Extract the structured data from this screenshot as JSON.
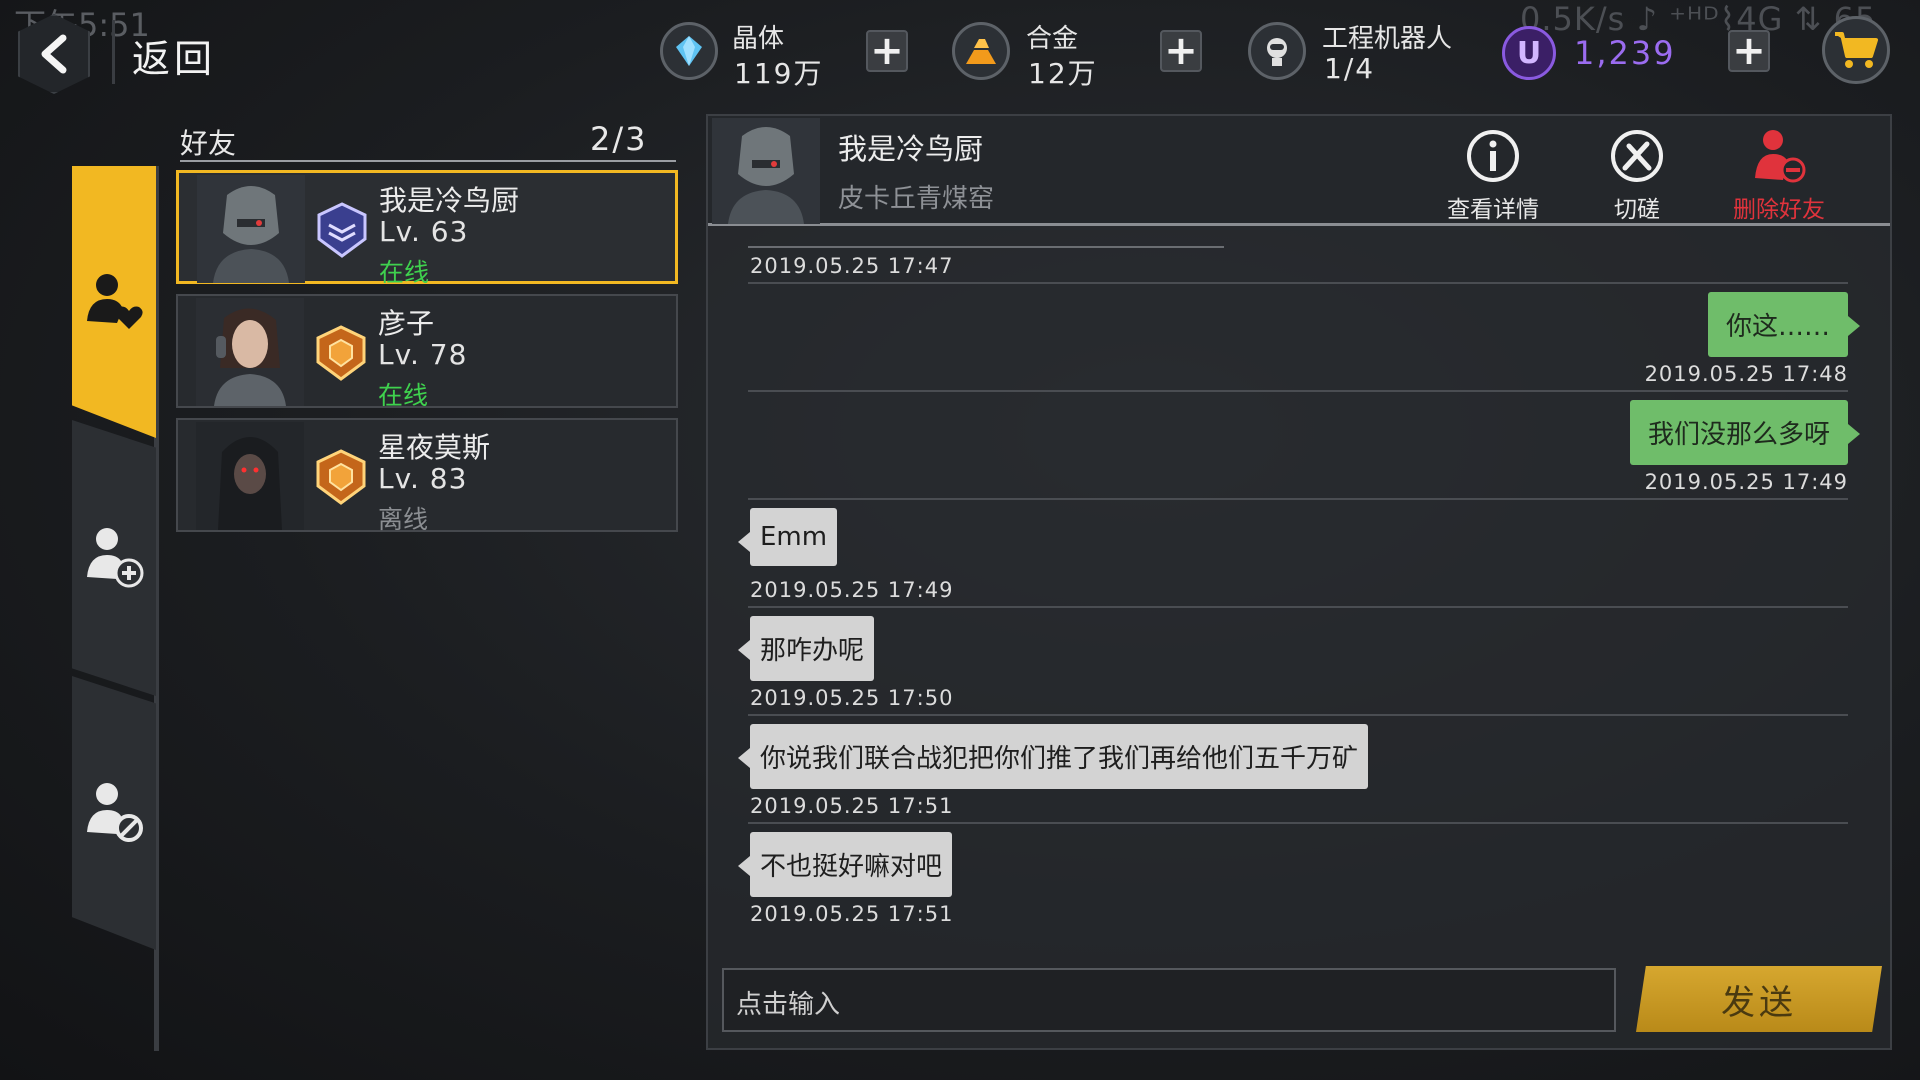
{
  "status_bar": {
    "time": "下午5:51",
    "right": "0.5K/s ♪ ⁺ᴴᴰ⌇4G ⇅ 65"
  },
  "header": {
    "back_label": "返回",
    "resources": [
      {
        "name": "晶体",
        "value": "119万",
        "icon": "crystal-icon"
      },
      {
        "name": "合金",
        "value": "12万",
        "icon": "alloy-icon"
      },
      {
        "name": "工程机器人",
        "value": "1/4",
        "icon": "robot-icon"
      }
    ],
    "currency": {
      "symbol": "U",
      "value": "1,239"
    },
    "plus": "+"
  },
  "friends_list": {
    "title": "好友",
    "count": "2/3",
    "items": [
      {
        "name": "我是冷鸟厨",
        "level": "Lv. 63",
        "status": "在线",
        "online": true,
        "rank": "silver-rank-icon"
      },
      {
        "name": "彦子",
        "level": "Lv. 78",
        "status": "在线",
        "online": true,
        "rank": "gold-rank-icon"
      },
      {
        "name": "星夜莫斯",
        "level": "Lv. 83",
        "status": "离线",
        "online": false,
        "rank": "gold-rank-icon"
      }
    ]
  },
  "chat": {
    "name": "我是冷鸟厨",
    "subtitle": "皮卡丘青煤窑",
    "actions": {
      "details": "查看详情",
      "spar": "切磋",
      "delete": "删除好友"
    },
    "first_timestamp": "2019.05.25 17:47",
    "messages": [
      {
        "side": "right",
        "text": "你这……",
        "time": "2019.05.25 17:48"
      },
      {
        "side": "right",
        "text": "我们没那么多呀",
        "time": "2019.05.25 17:49"
      },
      {
        "side": "left",
        "text": "Emm",
        "time": "2019.05.25 17:49"
      },
      {
        "side": "left",
        "text": "那咋办呢",
        "time": "2019.05.25 17:50"
      },
      {
        "side": "left",
        "text": "你说我们联合战犯把你们推了我们再给他们五千万矿",
        "time": "2019.05.25 17:51"
      },
      {
        "side": "left",
        "text": "不也挺好嘛对吧",
        "time": "2019.05.25 17:51"
      }
    ],
    "input_placeholder": "点击输入",
    "send_label": "发送"
  },
  "colors": {
    "accent": "#f2b822",
    "online": "#3fd14e",
    "danger": "#e0333c",
    "bubble_self": "#6fbd6a",
    "bubble_other": "#d3d3d3",
    "currency": "#9b6cf0"
  }
}
